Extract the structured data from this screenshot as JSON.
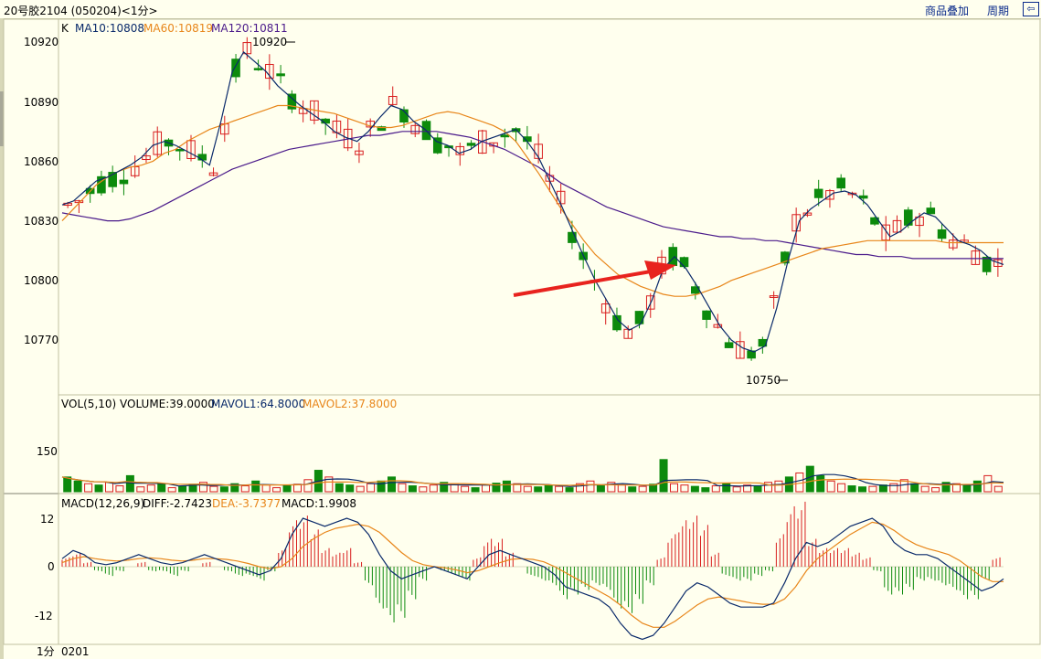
{
  "header": {
    "title": "20号胶2104 (050204)<1分>",
    "overlay_label": "商品叠加",
    "period_label": "周期",
    "back_icon": "arrow-left-icon"
  },
  "colors": {
    "background": "#FFFFEE",
    "up": "#D81E1E",
    "down": "#0C8A0C",
    "ma10": "#0A2A6A",
    "ma60": "#E8861A",
    "ma120": "#4A1A8A",
    "arrow": "#E8231E"
  },
  "price_panel": {
    "legend": {
      "k": "K",
      "ma10": "MA10:10808",
      "ma60": "MA60:10819",
      "ma120": "MA120:10811"
    },
    "y_ticks": [
      "10920",
      "10890",
      "10860",
      "10830",
      "10800",
      "10770"
    ],
    "high_mark": "10920",
    "low_mark": "10750"
  },
  "volume_panel": {
    "legend": {
      "name": "VOL(5,10)",
      "volume": "VOLUME:39.0000",
      "mavol1": "MAVOL1:64.8000",
      "mavol2": "MAVOL2:37.8000"
    },
    "y_ticks": [
      "150"
    ]
  },
  "macd_panel": {
    "legend": {
      "name": "MACD(12,26,9)",
      "diff": "DIFF:-2.7423",
      "dea": "DEA:-3.7377",
      "macd": "MACD:1.9908"
    },
    "y_ticks": [
      "12",
      "0",
      "-12"
    ]
  },
  "footer": {
    "period": "1分",
    "date": "0201"
  },
  "chart_data": [
    {
      "type": "candlestick",
      "title": "",
      "ylim": [
        10745,
        10925
      ],
      "y_ticks": [
        10920,
        10890,
        10860,
        10830,
        10800,
        10770
      ],
      "series": [
        {
          "name": "MA10",
          "value": 10808
        },
        {
          "name": "MA60",
          "value": 10819
        },
        {
          "name": "MA120",
          "value": 10811
        }
      ],
      "ma10_path": [
        10838,
        10840,
        10845,
        10850,
        10852,
        10855,
        10858,
        10862,
        10868,
        10870,
        10868,
        10865,
        10862,
        10858,
        10880,
        10905,
        10915,
        10910,
        10905,
        10898,
        10893,
        10888,
        10884,
        10880,
        10875,
        10872,
        10870,
        10875,
        10882,
        10888,
        10886,
        10880,
        10876,
        10870,
        10868,
        10864,
        10866,
        10870,
        10872,
        10874,
        10876,
        10870,
        10862,
        10850,
        10838,
        10825,
        10812,
        10800,
        10790,
        10780,
        10775,
        10778,
        10790,
        10806,
        10812,
        10806,
        10797,
        10787,
        10777,
        10770,
        10766,
        10764,
        10767,
        10786,
        10810,
        10830,
        10836,
        10840,
        10844,
        10845,
        10843,
        10838,
        10830,
        10822,
        10825,
        10830,
        10834,
        10832,
        10826,
        10820,
        10818,
        10815,
        10810,
        10808
      ],
      "ma60_path": [
        10830,
        10836,
        10842,
        10848,
        10852,
        10855,
        10857,
        10858,
        10860,
        10864,
        10866,
        10870,
        10873,
        10876,
        10878,
        10880,
        10882,
        10884,
        10886,
        10888,
        10888,
        10887,
        10886,
        10885,
        10884,
        10882,
        10880,
        10878,
        10877,
        10877,
        10878,
        10880,
        10882,
        10884,
        10885,
        10884,
        10882,
        10880,
        10878,
        10875,
        10870,
        10862,
        10854,
        10845,
        10836,
        10828,
        10820,
        10813,
        10808,
        10803,
        10800,
        10797,
        10795,
        10793,
        10792,
        10792,
        10793,
        10795,
        10797,
        10800,
        10802,
        10804,
        10806,
        10808,
        10810,
        10812,
        10814,
        10816,
        10817,
        10818,
        10819,
        10820,
        10820,
        10820,
        10820,
        10820,
        10820,
        10820,
        10819,
        10819,
        10819,
        10819,
        10819,
        10819
      ],
      "ma120_path": [
        10834,
        10833,
        10832,
        10831,
        10830,
        10830,
        10831,
        10833,
        10835,
        10838,
        10841,
        10844,
        10847,
        10850,
        10853,
        10856,
        10858,
        10860,
        10862,
        10864,
        10866,
        10867,
        10868,
        10869,
        10870,
        10871,
        10872,
        10873,
        10873,
        10874,
        10875,
        10875,
        10875,
        10875,
        10874,
        10873,
        10872,
        10870,
        10868,
        10866,
        10863,
        10860,
        10857,
        10853,
        10849,
        10846,
        10843,
        10840,
        10837,
        10835,
        10833,
        10831,
        10829,
        10827,
        10826,
        10825,
        10824,
        10823,
        10822,
        10822,
        10821,
        10821,
        10820,
        10820,
        10819,
        10818,
        10817,
        10816,
        10815,
        10814,
        10813,
        10813,
        10812,
        10812,
        10812,
        10811,
        10811,
        10811,
        10811,
        10811,
        10811,
        10811,
        10811,
        10811
      ],
      "annotations": [
        {
          "text": "10920",
          "kind": "high"
        },
        {
          "text": "10750",
          "kind": "low"
        }
      ]
    },
    {
      "type": "bar",
      "title": "",
      "series": [
        {
          "name": "VOLUME",
          "value": 39.0
        },
        {
          "name": "MAVOL1",
          "value": 64.8
        },
        {
          "name": "MAVOL2",
          "value": 37.8
        }
      ],
      "y_ticks": [
        150
      ],
      "volumes": [
        55,
        40,
        30,
        25,
        35,
        22,
        60,
        18,
        25,
        30,
        15,
        20,
        28,
        35,
        20,
        18,
        30,
        22,
        40,
        25,
        15,
        22,
        28,
        45,
        80,
        55,
        30,
        25,
        20,
        30,
        40,
        55,
        30,
        22,
        18,
        25,
        35,
        30,
        20,
        15,
        25,
        32,
        40,
        30,
        20,
        18,
        25,
        20,
        15,
        30,
        40,
        22,
        35,
        25,
        18,
        20,
        28,
        120,
        30,
        25,
        20,
        15,
        22,
        30,
        18,
        25,
        20,
        35,
        40,
        55,
        70,
        95,
        60,
        40,
        30,
        22,
        18,
        20,
        25,
        30,
        45,
        30,
        20,
        15,
        35,
        30,
        25,
        40,
        60,
        20
      ]
    },
    {
      "type": "bar",
      "title": "",
      "series": [
        {
          "name": "DIFF",
          "value": -2.7423
        },
        {
          "name": "DEA",
          "value": -3.7377
        },
        {
          "name": "MACD",
          "value": 1.9908
        }
      ],
      "ylim": [
        -20,
        13
      ],
      "y_ticks": [
        12,
        0,
        -12
      ],
      "diff_path": [
        2,
        4,
        3,
        1,
        0.5,
        1,
        2,
        3,
        2,
        1,
        0.5,
        1,
        2,
        3,
        2,
        1,
        0,
        -1,
        -2,
        -1,
        2,
        8,
        12,
        11,
        10,
        11,
        12,
        11,
        8,
        3,
        -1,
        -3,
        -2,
        -1,
        0,
        -1,
        -2,
        -3,
        0,
        3,
        4,
        3,
        2,
        1,
        0,
        -2,
        -5,
        -6,
        -7,
        -8,
        -10,
        -14,
        -17,
        -18,
        -17,
        -14,
        -10,
        -6,
        -4,
        -5,
        -7,
        -9,
        -10,
        -10,
        -10,
        -9,
        -4,
        2,
        6,
        5,
        6,
        8,
        10,
        11,
        12,
        10,
        6,
        4,
        3,
        3,
        2,
        0,
        -2,
        -4,
        -6,
        -5,
        -3
      ],
      "dea_path": [
        1,
        2,
        2.5,
        2,
        1.6,
        1.4,
        1.6,
        2,
        2.2,
        2,
        1.6,
        1.4,
        1.6,
        2,
        2,
        1.8,
        1.4,
        0.8,
        0,
        -0.5,
        0,
        2,
        5,
        7,
        8.5,
        9.5,
        10,
        10.5,
        10,
        8.5,
        6,
        3.5,
        1.5,
        0.5,
        0,
        -0.3,
        -0.8,
        -1.5,
        -1,
        0,
        1,
        1.8,
        2,
        1.8,
        1.2,
        0,
        -1.5,
        -3,
        -4.5,
        -6,
        -7.5,
        -9.5,
        -12,
        -14,
        -15,
        -15,
        -13.5,
        -11.5,
        -9.5,
        -8,
        -7.5,
        -8,
        -8.5,
        -9,
        -9.3,
        -9.3,
        -8,
        -5,
        -1,
        2,
        4,
        6,
        8,
        9.5,
        11,
        10.5,
        9,
        7,
        5.5,
        4.5,
        3.8,
        3,
        1.5,
        -0.5,
        -2.5,
        -3.7,
        -3.7
      ],
      "macd_bars": [
        2,
        3,
        1,
        -1,
        -2,
        -1,
        0,
        1,
        -1,
        -1,
        -2,
        -1,
        0,
        1,
        0,
        -1,
        -2,
        -2,
        -3,
        -1,
        4,
        10,
        11,
        8,
        4,
        3,
        4,
        1,
        -4,
        -9,
        -12,
        -11,
        -7,
        -3,
        0,
        -1,
        -2,
        -3,
        2,
        6,
        6,
        3,
        0,
        -2,
        -3,
        -4,
        -7,
        -6,
        -5,
        -4,
        -5,
        -9,
        -10,
        -8,
        -4,
        2,
        7,
        10,
        11,
        9,
        3,
        -2,
        -3,
        -3,
        -2,
        -1,
        7,
        13,
        14,
        6,
        4,
        4,
        4,
        3,
        2,
        -1,
        -6,
        -6,
        -5,
        -3,
        -3,
        -4,
        -5,
        -7,
        -7,
        -3,
        2
      ]
    }
  ]
}
